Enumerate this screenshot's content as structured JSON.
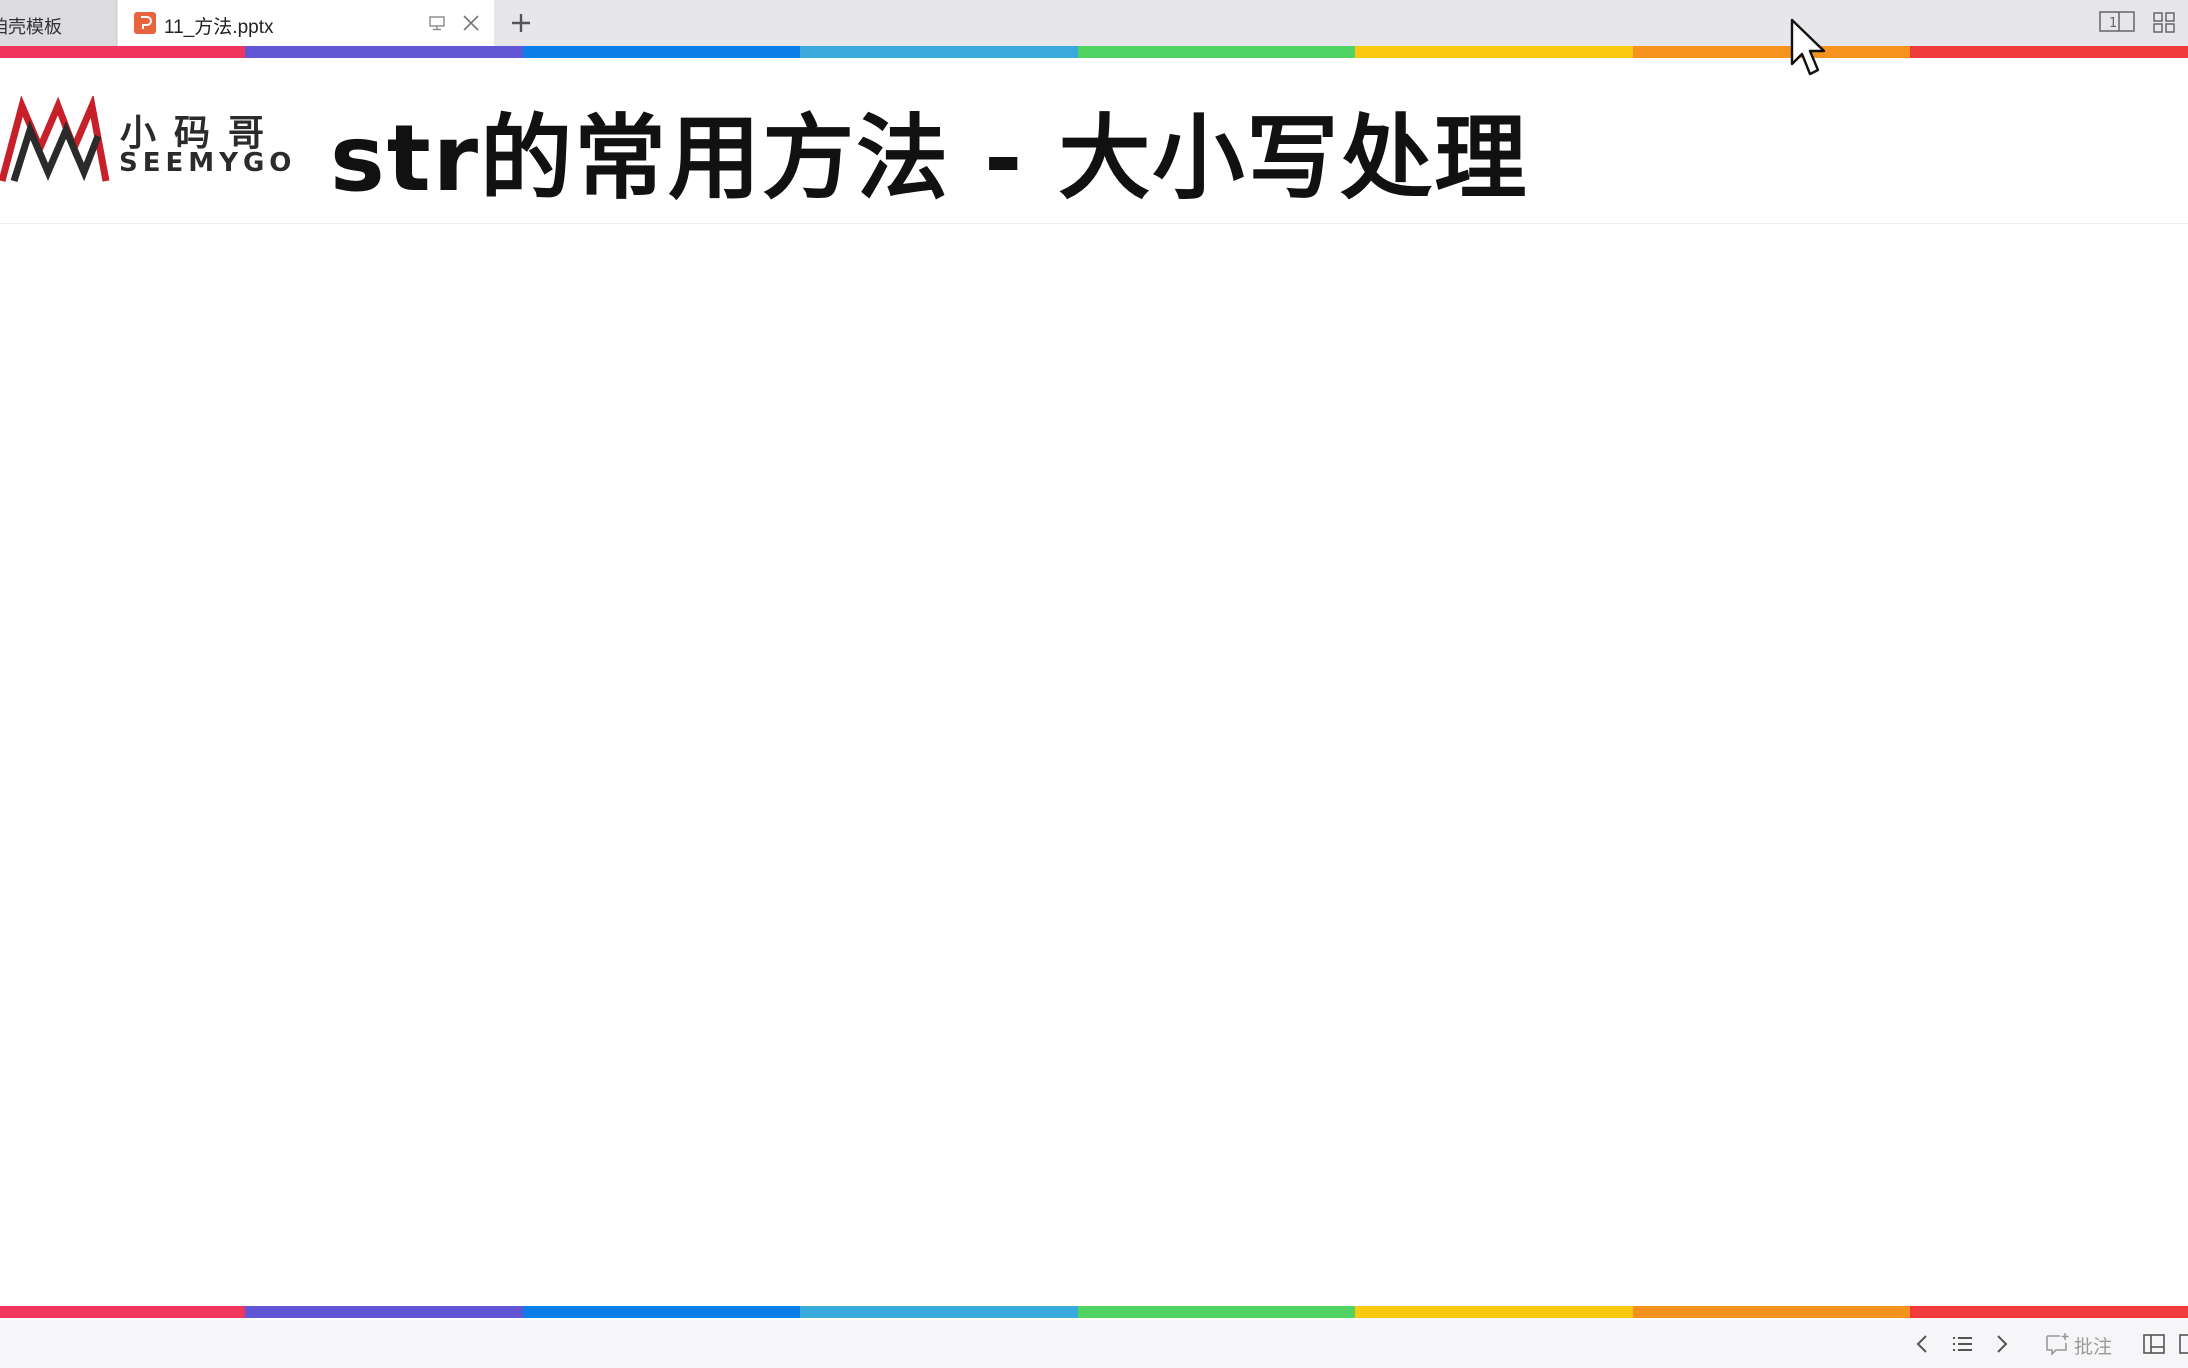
{
  "tabs": {
    "inactive_label": "咱壳模板",
    "active_label": "11_方法.pptx"
  },
  "slide": {
    "logo_cn": "小码哥",
    "logo_en": "SEEMYGO",
    "title": "str的常用方法 - 大小写处理"
  },
  "stripe_colors": [
    "#f0365d",
    "#6157d6",
    "#0a7fe8",
    "#3aa9db",
    "#4fd464",
    "#f9c80f",
    "#f6921e",
    "#ef3b3b"
  ],
  "statusbar": {
    "comment_label": "批注"
  },
  "icons": {
    "tab_file": "pptx-file-icon",
    "present": "present-icon",
    "close": "close-icon",
    "new_tab": "plus-icon",
    "reading_view": "reading-view-icon",
    "grid_view": "grid-icon",
    "prev": "chevron-left-icon",
    "list": "list-icon",
    "next": "chevron-right-icon",
    "comment": "comment-icon",
    "normal_view": "normal-view-icon"
  }
}
